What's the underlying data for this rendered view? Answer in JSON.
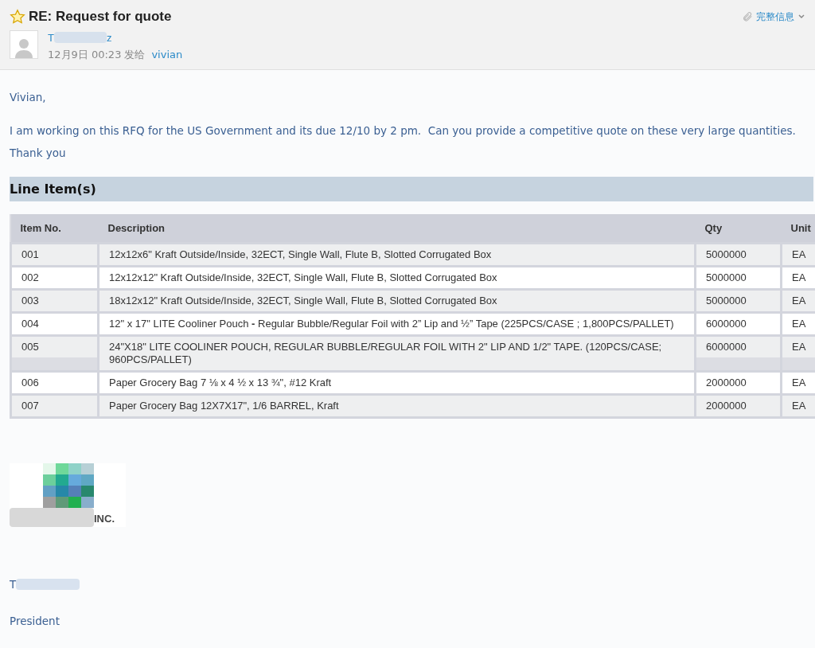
{
  "header": {
    "subject": "RE: Request for quote",
    "starred": false,
    "details_link": "完整信息",
    "sender_start": "T",
    "sender_end": "z",
    "date": "12月9日 00:23",
    "sent_to_label": "发给",
    "recipient": "vivian"
  },
  "body": {
    "greeting": "Vivian,",
    "paragraphs": [
      "I am working on this RFQ for the US Government and its due 12/10 by 2 pm.  Can you provide a competitive quote on these very large quantities.",
      "Thank you"
    ]
  },
  "section_title": "Line Item(s)",
  "table": {
    "columns": [
      "Item No.",
      "Description",
      "Qty",
      "Unit"
    ],
    "rows": [
      [
        "001",
        "12x12x6\" Kraft Outside/Inside, 32ECT, Single Wall, Flute B, Slotted Corrugated Box",
        "5000000",
        "EA"
      ],
      [
        "002",
        "12x12x12\" Kraft Outside/Inside, 32ECT, Single Wall, Flute B, Slotted Corrugated Box",
        "5000000",
        "EA"
      ],
      [
        "003",
        "18x12x12\" Kraft Outside/Inside, 32ECT, Single Wall, Flute B, Slotted Corrugated Box",
        "5000000",
        "EA"
      ],
      [
        "004",
        "12\" x 17\" LITE Cooliner Pouch **-** Regular Bubble/Regular Foil with 2” Lip and ½” Tape (225PCS/CASE ; 1,800PCS/PALLET)",
        "6000000",
        "EA"
      ],
      [
        "005",
        "24\"X18\" LITE COOLINER POUCH, REGULAR BUBBLE/REGULAR FOIL WITH 2\" LIP AND 1/2\" TAPE. (120PCS/CASE; 960PCS/PALLET)",
        "6000000",
        "EA"
      ],
      [
        "006",
        "Paper Grocery Bag 7 ⅛ x 4 ½ x 13 ¾\", #12 Kraft",
        "2000000",
        "EA"
      ],
      [
        "007",
        "Paper Grocery Bag 12X7X17\", 1/6 BARREL, Kraft",
        "2000000",
        "EA"
      ]
    ]
  },
  "signature": {
    "logo_text": "INC.",
    "name_start": "T",
    "title": "President"
  }
}
